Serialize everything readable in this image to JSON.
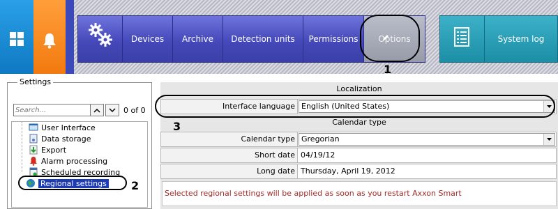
{
  "topbar": {
    "tiles": [
      {
        "icon": "windows-icon",
        "color": "#1a8ad6"
      },
      {
        "icon": "bell-icon",
        "color": "#f6861e"
      }
    ],
    "nav": [
      {
        "icon": "gears-icon"
      },
      {
        "label": "Devices"
      },
      {
        "label": "Archive"
      },
      {
        "label": "Detection units"
      },
      {
        "label": "Permissions"
      },
      {
        "label": "Options",
        "active": true
      }
    ],
    "system_log": {
      "icon": "checklist-icon",
      "label": "System log"
    }
  },
  "markers": [
    "1",
    "2",
    "3"
  ],
  "settings_panel": {
    "title": "Settings",
    "search_placeholder": "Search...",
    "match_count": "0 of 0",
    "tree": [
      {
        "label": "User Interface",
        "icon": "user-interface-icon"
      },
      {
        "label": "Data storage",
        "icon": "data-storage-icon"
      },
      {
        "label": "Export",
        "icon": "export-icon"
      },
      {
        "label": "Alarm processing",
        "icon": "alarm-processing-icon"
      },
      {
        "label": "Scheduled recording",
        "icon": "scheduled-recording-icon"
      },
      {
        "label": "Regional settings",
        "icon": "globe-icon",
        "selected": true
      }
    ]
  },
  "localization": {
    "title": "Localization",
    "interface_language_label": "Interface language",
    "interface_language_value": "English (United States)"
  },
  "calendar": {
    "title": "Calendar type",
    "calendar_type_label": "Calendar type",
    "calendar_type_value": "Gregorian",
    "short_date_label": "Short date",
    "short_date_value": "04/19/12",
    "long_date_label": "Long date",
    "long_date_value": "Thursday, April 19, 2012"
  },
  "notice": "Selected regional settings will be applied as soon as you restart Axxon Smart",
  "colors": {
    "accent": "#4549b9",
    "selection": "#1d3cb4",
    "notice": "#a62828",
    "teal": "#1c8ea6"
  }
}
